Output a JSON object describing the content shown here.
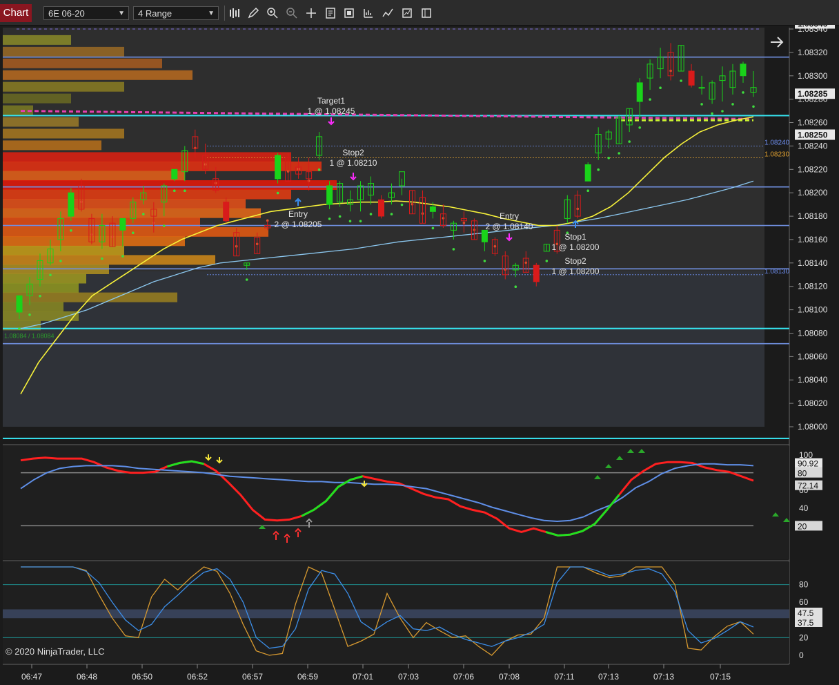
{
  "toolbar": {
    "tab_label": "Chart",
    "instrument": "6E 06-20",
    "bar_type": "4 Range",
    "icons": [
      "bars-icon",
      "pencil-icon",
      "zoom-in-icon",
      "zoom-out-icon",
      "crosshair-icon",
      "properties-icon",
      "indicators-icon",
      "strategies-icon",
      "chart-style-icon",
      "template-icon",
      "data-box-icon"
    ]
  },
  "copyright": "© 2020 NinjaTrader, LLC",
  "colors": {
    "background": "#1b1b1b",
    "panel": "#2d2d2d",
    "up_bar": "#1ad31a",
    "down_bar": "#d81b1b",
    "ema_fast": "#f7f23a",
    "ema_slow": "#8cc8f0",
    "cyan_line": "#35e6f0",
    "level_line": "#7090e0"
  },
  "chart_data": [
    {
      "type": "candlestick",
      "panel": "price",
      "ylim": [
        1.07985,
        1.0835
      ],
      "y_ticks": [
        "1.08340",
        "1.08320",
        "1.08300",
        "1.08280",
        "1.08260",
        "1.08240",
        "1.08220",
        "1.08200",
        "1.08180",
        "1.08160",
        "1.08140",
        "1.08120",
        "1.08100",
        "1.08080",
        "1.08060",
        "1.08040",
        "1.08020",
        "1.08000"
      ],
      "x_ticks": [
        "06:47",
        "06:48",
        "06:50",
        "06:52",
        "06:57",
        "06:59",
        "07:01",
        "07:03",
        "07:06",
        "07:08",
        "07:11",
        "07:13",
        "07:13",
        "07:15"
      ],
      "price_badges": [
        "1.08345",
        "1.08285",
        "1.08250"
      ],
      "hidden_badge": "1.08260",
      "marker_labels": [
        "1.08240",
        "1.08230",
        "1.08130"
      ],
      "left_label": "1.08084 / 1.08084",
      "bars": [
        {
          "o": 1.08098,
          "h": 1.0811,
          "l": 1.08092,
          "c": 1.08112
        },
        {
          "o": 1.08112,
          "h": 1.08128,
          "l": 1.08104,
          "c": 1.08122
        },
        {
          "o": 1.08126,
          "h": 1.08148,
          "l": 1.0812,
          "c": 1.08142
        },
        {
          "o": 1.0814,
          "h": 1.0816,
          "l": 1.08138,
          "c": 1.08152
        },
        {
          "o": 1.0816,
          "h": 1.08184,
          "l": 1.0815,
          "c": 1.08178
        },
        {
          "o": 1.0818,
          "h": 1.08204,
          "l": 1.08176,
          "c": 1.082
        },
        {
          "o": 1.08206,
          "h": 1.08212,
          "l": 1.08184,
          "c": 1.08186
        },
        {
          "o": 1.08178,
          "h": 1.08182,
          "l": 1.08156,
          "c": 1.08158
        },
        {
          "o": 1.08158,
          "h": 1.08182,
          "l": 1.08152,
          "c": 1.08172
        },
        {
          "o": 1.08174,
          "h": 1.0818,
          "l": 1.08154,
          "c": 1.08154
        },
        {
          "o": 1.08168,
          "h": 1.08178,
          "l": 1.08154,
          "c": 1.08178
        },
        {
          "o": 1.08178,
          "h": 1.08196,
          "l": 1.08174,
          "c": 1.08192
        },
        {
          "o": 1.08194,
          "h": 1.08206,
          "l": 1.0819,
          "c": 1.082
        },
        {
          "o": 1.08186,
          "h": 1.08192,
          "l": 1.08166,
          "c": 1.0818
        },
        {
          "o": 1.08192,
          "h": 1.08208,
          "l": 1.0818,
          "c": 1.08206
        },
        {
          "o": 1.08212,
          "h": 1.0822,
          "l": 1.0821,
          "c": 1.0822
        },
        {
          "o": 1.08218,
          "h": 1.0824,
          "l": 1.0821,
          "c": 1.08236
        },
        {
          "o": 1.08248,
          "h": 1.08254,
          "l": 1.0823,
          "c": 1.08238
        },
        {
          "o": 1.08232,
          "h": 1.08242,
          "l": 1.08216,
          "c": 1.0822
        },
        {
          "o": 1.08212,
          "h": 1.08222,
          "l": 1.082,
          "c": 1.08202
        },
        {
          "o": 1.08192,
          "h": 1.08196,
          "l": 1.08174,
          "c": 1.08176
        },
        {
          "o": 1.08166,
          "h": 1.0817,
          "l": 1.08146,
          "c": 1.08146
        },
        {
          "o": 1.08138,
          "h": 1.0814,
          "l": 1.08134,
          "c": 1.0814
        },
        {
          "o": 1.08162,
          "h": 1.08166,
          "l": 1.08148,
          "c": 1.08148
        },
        {
          "o": 1.08172,
          "h": 1.08176,
          "l": 1.08168,
          "c": 1.0817
        },
        {
          "o": 1.08212,
          "h": 1.08234,
          "l": 1.08208,
          "c": 1.08232
        },
        {
          "o": 1.0823,
          "h": 1.08234,
          "l": 1.0821,
          "c": 1.0821
        },
        {
          "o": 1.08222,
          "h": 1.0823,
          "l": 1.08212,
          "c": 1.08216
        },
        {
          "o": 1.08218,
          "h": 1.0823,
          "l": 1.08202,
          "c": 1.08212
        },
        {
          "o": 1.08232,
          "h": 1.08252,
          "l": 1.08228,
          "c": 1.08248
        },
        {
          "o": 1.0819,
          "h": 1.0821,
          "l": 1.08186,
          "c": 1.08206
        },
        {
          "o": 1.08192,
          "h": 1.0821,
          "l": 1.08188,
          "c": 1.08208
        },
        {
          "o": 1.0819,
          "h": 1.08202,
          "l": 1.08184,
          "c": 1.08194
        },
        {
          "o": 1.08194,
          "h": 1.0821,
          "l": 1.08184,
          "c": 1.08206
        },
        {
          "o": 1.08198,
          "h": 1.08214,
          "l": 1.0819,
          "c": 1.08208
        },
        {
          "o": 1.08194,
          "h": 1.08198,
          "l": 1.08178,
          "c": 1.0818
        },
        {
          "o": 1.08196,
          "h": 1.08208,
          "l": 1.0819,
          "c": 1.082
        },
        {
          "o": 1.08206,
          "h": 1.08212,
          "l": 1.08198,
          "c": 1.08218
        },
        {
          "o": 1.08202,
          "h": 1.08202,
          "l": 1.08182,
          "c": 1.08182
        },
        {
          "o": 1.08196,
          "h": 1.08202,
          "l": 1.08174,
          "c": 1.08174
        },
        {
          "o": 1.08184,
          "h": 1.08192,
          "l": 1.08178,
          "c": 1.08188
        },
        {
          "o": 1.08182,
          "h": 1.0819,
          "l": 1.0817,
          "c": 1.08172
        },
        {
          "o": 1.08168,
          "h": 1.08176,
          "l": 1.0816,
          "c": 1.08174
        },
        {
          "o": 1.08178,
          "h": 1.08184,
          "l": 1.08166,
          "c": 1.08176
        },
        {
          "o": 1.08176,
          "h": 1.08178,
          "l": 1.0816,
          "c": 1.0816
        },
        {
          "o": 1.08158,
          "h": 1.08168,
          "l": 1.0815,
          "c": 1.08168
        },
        {
          "o": 1.0816,
          "h": 1.08162,
          "l": 1.08146,
          "c": 1.08148
        },
        {
          "o": 1.08146,
          "h": 1.0815,
          "l": 1.08126,
          "c": 1.0813
        },
        {
          "o": 1.08134,
          "h": 1.0814,
          "l": 1.08128,
          "c": 1.08138
        },
        {
          "o": 1.08144,
          "h": 1.0815,
          "l": 1.08132,
          "c": 1.08132
        },
        {
          "o": 1.08138,
          "h": 1.0814,
          "l": 1.0812,
          "c": 1.08124
        },
        {
          "o": 1.0815,
          "h": 1.08156,
          "l": 1.0815,
          "c": 1.08156
        },
        {
          "o": 1.08168,
          "h": 1.08172,
          "l": 1.08148,
          "c": 1.0815
        },
        {
          "o": 1.08178,
          "h": 1.08198,
          "l": 1.08174,
          "c": 1.08194
        },
        {
          "o": 1.08198,
          "h": 1.08202,
          "l": 1.08178,
          "c": 1.0818
        },
        {
          "o": 1.0821,
          "h": 1.08226,
          "l": 1.0821,
          "c": 1.08224
        },
        {
          "o": 1.08234,
          "h": 1.08256,
          "l": 1.08228,
          "c": 1.0825
        },
        {
          "o": 1.08246,
          "h": 1.08254,
          "l": 1.08238,
          "c": 1.08252
        },
        {
          "o": 1.08242,
          "h": 1.08266,
          "l": 1.08242,
          "c": 1.08264
        },
        {
          "o": 1.08258,
          "h": 1.08272,
          "l": 1.08252,
          "c": 1.08272
        },
        {
          "o": 1.08278,
          "h": 1.08298,
          "l": 1.08264,
          "c": 1.08294
        },
        {
          "o": 1.08298,
          "h": 1.08314,
          "l": 1.08288,
          "c": 1.0831
        },
        {
          "o": 1.08306,
          "h": 1.08324,
          "l": 1.08298,
          "c": 1.08316
        },
        {
          "o": 1.0832,
          "h": 1.08328,
          "l": 1.08296,
          "c": 1.083
        },
        {
          "o": 1.08304,
          "h": 1.08326,
          "l": 1.08304,
          "c": 1.08326
        },
        {
          "o": 1.08304,
          "h": 1.0831,
          "l": 1.0829,
          "c": 1.08292
        },
        {
          "o": 1.0829,
          "h": 1.083,
          "l": 1.08284,
          "c": 1.0829
        },
        {
          "o": 1.0828,
          "h": 1.08296,
          "l": 1.08276,
          "c": 1.08294
        },
        {
          "o": 1.08296,
          "h": 1.08308,
          "l": 1.08278,
          "c": 1.083
        },
        {
          "o": 1.0829,
          "h": 1.0831,
          "l": 1.08284,
          "c": 1.08304
        },
        {
          "o": 1.083,
          "h": 1.08312,
          "l": 1.08294,
          "c": 1.0831
        },
        {
          "o": 1.08286,
          "h": 1.08304,
          "l": 1.08282,
          "c": 1.0829
        }
      ],
      "horizontal_levels": [
        1.08316,
        1.08266,
        1.08205,
        1.08172,
        1.08135,
        1.08084,
        1.08071,
        1.0799
      ],
      "cyan_levels": [
        1.08266,
        1.08084,
        1.0799
      ],
      "order_labels": [
        {
          "title": "Target1",
          "text": "1 @ 1.08245"
        },
        {
          "title": "Stop2",
          "text": "1 @ 1.08210"
        },
        {
          "title": "Entry",
          "text": "2 @ 1.08205"
        },
        {
          "title": "Entry",
          "text": "2 @ 1.08140"
        },
        {
          "title": "Stop1",
          "text": "1 @ 1.08200"
        },
        {
          "title": "Stop2",
          "text": "1 @ 1.08200"
        }
      ],
      "ema_fast": [
        1.08028,
        1.08055,
        1.08075,
        1.08095,
        1.08112,
        1.08122,
        1.08132,
        1.08142,
        1.08152,
        1.0816,
        1.08166,
        1.08172,
        1.08176,
        1.0818,
        1.08184,
        1.08186,
        1.08188,
        1.0819,
        1.08191,
        1.08192,
        1.08192,
        1.08193,
        1.08192,
        1.0819,
        1.08188,
        1.08185,
        1.08182,
        1.08178,
        1.08175,
        1.08172,
        1.08172,
        1.08175,
        1.0818,
        1.08188,
        1.082,
        1.08215,
        1.0823,
        1.08242,
        1.08252,
        1.08258,
        1.08262,
        1.08265
      ],
      "ema_slow": [
        1.08084,
        1.08088,
        1.08094,
        1.081,
        1.08108,
        1.08116,
        1.08124,
        1.0813,
        1.08136,
        1.0814,
        1.08142,
        1.08144,
        1.08146,
        1.08148,
        1.0815,
        1.08152,
        1.08155,
        1.08158,
        1.0816,
        1.08162,
        1.08164,
        1.08166,
        1.08168,
        1.0817,
        1.08172,
        1.08175,
        1.08178,
        1.08182,
        1.08186,
        1.0819,
        1.08194,
        1.08199,
        1.08204,
        1.0821
      ],
      "volume_profile": [
        {
          "price": 1.0833,
          "vol": 0.09
        },
        {
          "price": 1.0832,
          "vol": 0.16
        },
        {
          "price": 1.0831,
          "vol": 0.21
        },
        {
          "price": 1.083,
          "vol": 0.25
        },
        {
          "price": 1.0829,
          "vol": 0.16
        },
        {
          "price": 1.0828,
          "vol": 0.09
        },
        {
          "price": 1.0827,
          "vol": 0.04
        },
        {
          "price": 1.0826,
          "vol": 0.1
        },
        {
          "price": 1.0825,
          "vol": 0.16
        },
        {
          "price": 1.0824,
          "vol": 0.13
        },
        {
          "price": 1.0823,
          "vol": 0.38
        },
        {
          "price": 1.08222,
          "vol": 0.42
        },
        {
          "price": 1.08214,
          "vol": 0.24
        },
        {
          "price": 1.08206,
          "vol": 0.44
        },
        {
          "price": 1.08198,
          "vol": 0.38
        },
        {
          "price": 1.0819,
          "vol": 0.32
        },
        {
          "price": 1.08182,
          "vol": 0.34
        },
        {
          "price": 1.08174,
          "vol": 0.26
        },
        {
          "price": 1.08166,
          "vol": 0.35
        },
        {
          "price": 1.08158,
          "vol": 0.24
        },
        {
          "price": 1.0815,
          "vol": 0.16
        },
        {
          "price": 1.08142,
          "vol": 0.28
        },
        {
          "price": 1.08134,
          "vol": 0.14
        },
        {
          "price": 1.08126,
          "vol": 0.11
        },
        {
          "price": 1.08118,
          "vol": 0.1
        },
        {
          "price": 1.0811,
          "vol": 0.23
        },
        {
          "price": 1.08102,
          "vol": 0.08
        },
        {
          "price": 1.08094,
          "vol": 0.1
        },
        {
          "price": 1.08086,
          "vol": 0.05
        }
      ]
    },
    {
      "type": "line",
      "panel": "oscillator-1",
      "ylim": [
        0,
        100
      ],
      "y_ticks": [
        "100",
        "80",
        "60",
        "40",
        "20"
      ],
      "badges": [
        "90.92",
        "80",
        "72.14",
        "20"
      ],
      "levels": [
        80,
        20
      ],
      "series": [
        {
          "values": [
            94,
            96,
            97,
            96,
            96,
            96,
            92,
            86,
            82,
            80,
            80,
            81,
            87,
            91,
            93,
            90,
            82,
            69,
            55,
            38,
            27,
            26,
            27,
            31,
            38,
            48,
            64,
            72,
            76,
            73,
            70,
            68,
            62,
            56,
            52,
            50,
            42,
            38,
            35,
            28,
            17,
            13,
            17,
            13,
            9,
            10,
            14,
            22,
            38,
            55,
            72,
            82,
            90,
            92,
            92,
            91,
            86,
            83,
            81,
            76,
            71
          ]
        },
        {
          "values": [
            62,
            72,
            80,
            85,
            87,
            88,
            88,
            88,
            87,
            85,
            84,
            83,
            82,
            81,
            80,
            78,
            76,
            75,
            74,
            73,
            72,
            71,
            70,
            70,
            69,
            69,
            68,
            67,
            67,
            66,
            64,
            62,
            58,
            54,
            50,
            46,
            41,
            37,
            33,
            29,
            26,
            25,
            26,
            30,
            37,
            43,
            52,
            63,
            70,
            79,
            85,
            88,
            90,
            90,
            89,
            89,
            88
          ]
        }
      ]
    },
    {
      "type": "line",
      "panel": "oscillator-2",
      "ylim": [
        0,
        100
      ],
      "y_ticks": [
        "80",
        "60",
        "40",
        "20",
        "0"
      ],
      "badges": [
        "47.5",
        "37.5"
      ],
      "levels": [
        80,
        20
      ],
      "band": [
        42,
        52
      ],
      "series": [
        {
          "values": [
            100,
            100,
            100,
            100,
            100,
            96,
            68,
            42,
            22,
            20,
            66,
            86,
            74,
            88,
            100,
            95,
            70,
            35,
            5,
            0,
            2,
            58,
            100,
            93,
            52,
            10,
            16,
            24,
            70,
            42,
            20,
            37,
            28,
            20,
            22,
            10,
            0,
            16,
            23,
            24,
            42,
            100,
            100,
            100,
            93,
            88,
            90,
            100,
            100,
            100,
            80,
            8,
            6,
            21,
            33,
            38,
            24
          ]
        },
        {
          "values": [
            100,
            100,
            100,
            100,
            100,
            95,
            82,
            60,
            40,
            28,
            35,
            55,
            68,
            82,
            94,
            98,
            86,
            60,
            20,
            8,
            10,
            30,
            75,
            96,
            92,
            70,
            38,
            28,
            38,
            45,
            30,
            28,
            32,
            24,
            18,
            14,
            10,
            16,
            20,
            26,
            35,
            82,
            100,
            100,
            96,
            90,
            92,
            96,
            98,
            92,
            72,
            28,
            14,
            19,
            28,
            38,
            32
          ]
        }
      ]
    }
  ]
}
